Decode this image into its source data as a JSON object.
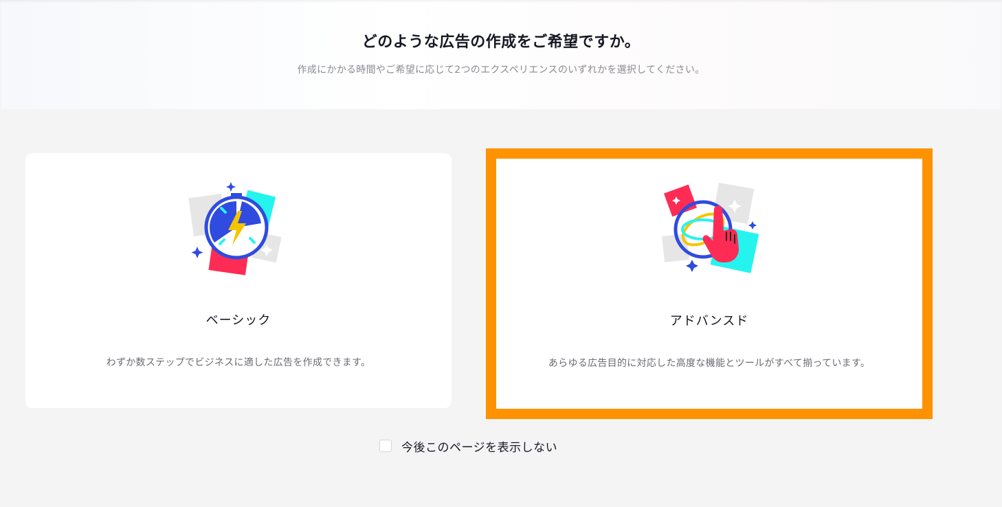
{
  "header": {
    "title": "どのような広告の作成をご希望ですか。",
    "subtitle": "作成にかかる時間やご希望に応じて2つのエクスペリエンスのいずれかを選択してください。"
  },
  "options": [
    {
      "id": "basic",
      "title": "ベーシック",
      "description": "わずか数ステップでビジネスに適した広告を作成できます。",
      "icon": "stopwatch-lightning-icon",
      "selected": false
    },
    {
      "id": "advanced",
      "title": "アドバンスド",
      "description": "あらゆる広告目的に対応した高度な機能とツールがすべて揃っています。",
      "icon": "globe-hand-icon",
      "selected": true
    }
  ],
  "footer": {
    "dont_show_label": "今後このページを表示しない",
    "dont_show_checked": false
  },
  "colors": {
    "highlight": "#ff9200",
    "blue": "#2f4be0",
    "cyan": "#25f4ee",
    "red": "#fe2c55",
    "yellow": "#f5c400"
  }
}
